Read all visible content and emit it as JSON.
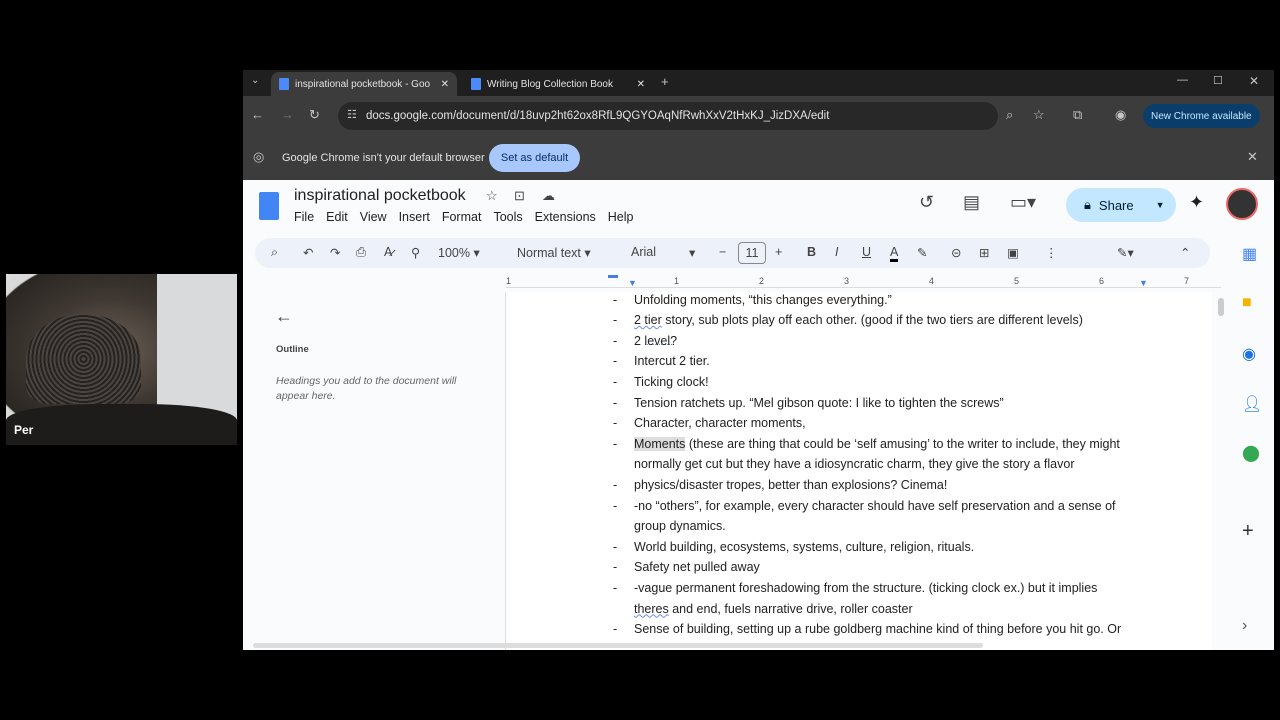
{
  "webcam": {
    "participant_label": "Per"
  },
  "browser": {
    "tabs": [
      {
        "title": "inspirational pocketbook - Goo",
        "active": true
      },
      {
        "title": "Writing Blog Collection Book",
        "active": false
      }
    ],
    "url": "docs.google.com/document/d/18uvp2ht62ox8RfL9QGYOAqNfRwhXxV2tHxKJ_JizDXA/edit",
    "new_chrome": "New Chrome available",
    "infobar": {
      "message": "Google Chrome isn't your default browser",
      "button": "Set as default"
    }
  },
  "doc": {
    "title": "inspirational pocketbook",
    "menu": [
      "File",
      "Edit",
      "View",
      "Insert",
      "Format",
      "Tools",
      "Extensions",
      "Help"
    ],
    "share": "Share",
    "toolbar": {
      "zoom": "100%",
      "style": "Normal text",
      "font": "Arial",
      "size": "11",
      "bold": "B",
      "italic": "I",
      "underline": "U",
      "color": "A"
    },
    "ruler": [
      "1",
      "1",
      "2",
      "3",
      "4",
      "5",
      "6",
      "7"
    ],
    "outline": {
      "label": "Outline",
      "empty": "Headings you add to the document will appear here."
    },
    "lines": [
      {
        "d": "-",
        "t": "Unfolding moments, “this changes everything.”"
      },
      {
        "d": "-",
        "t": "2 tier story, sub plots play off each other. (good if the two tiers are different levels)"
      },
      {
        "d": "-",
        "t": "2 level?"
      },
      {
        "d": "-",
        "t": "Intercut 2 tier."
      },
      {
        "d": "-",
        "t": "Ticking clock!"
      },
      {
        "d": "-",
        "t": "Tension ratchets up. “Mel gibson quote: I like to tighten the screws”"
      },
      {
        "d": "-",
        "t": "Character, character moments,"
      },
      {
        "d": "-",
        "t": "Moments (these are thing that could be ‘self amusing’ to the writer to include, they might"
      },
      {
        "d": "",
        "t": "normally get cut but they have a idiosyncratic charm, they give the story a flavor"
      },
      {
        "d": "-",
        "t": "physics/disaster tropes, better than explosions? Cinema!"
      },
      {
        "d": "-",
        "t": "-no “others”, for example, every character should have self preservation and a sense of"
      },
      {
        "d": "",
        "t": "group dynamics."
      },
      {
        "d": "-",
        "t": "World building, ecosystems, systems, culture, religion, rituals."
      },
      {
        "d": "-",
        "t": "Safety net pulled away"
      },
      {
        "d": "-",
        "t": "-vague permanent foreshadowing from the structure. (ticking clock ex.) but it implies"
      },
      {
        "d": "",
        "t": "theres and end, fuels narrative drive, roller coaster"
      },
      {
        "d": "-",
        "t": "Sense of building, setting up a rube goldberg machine kind of thing before you hit go. Or"
      }
    ]
  }
}
